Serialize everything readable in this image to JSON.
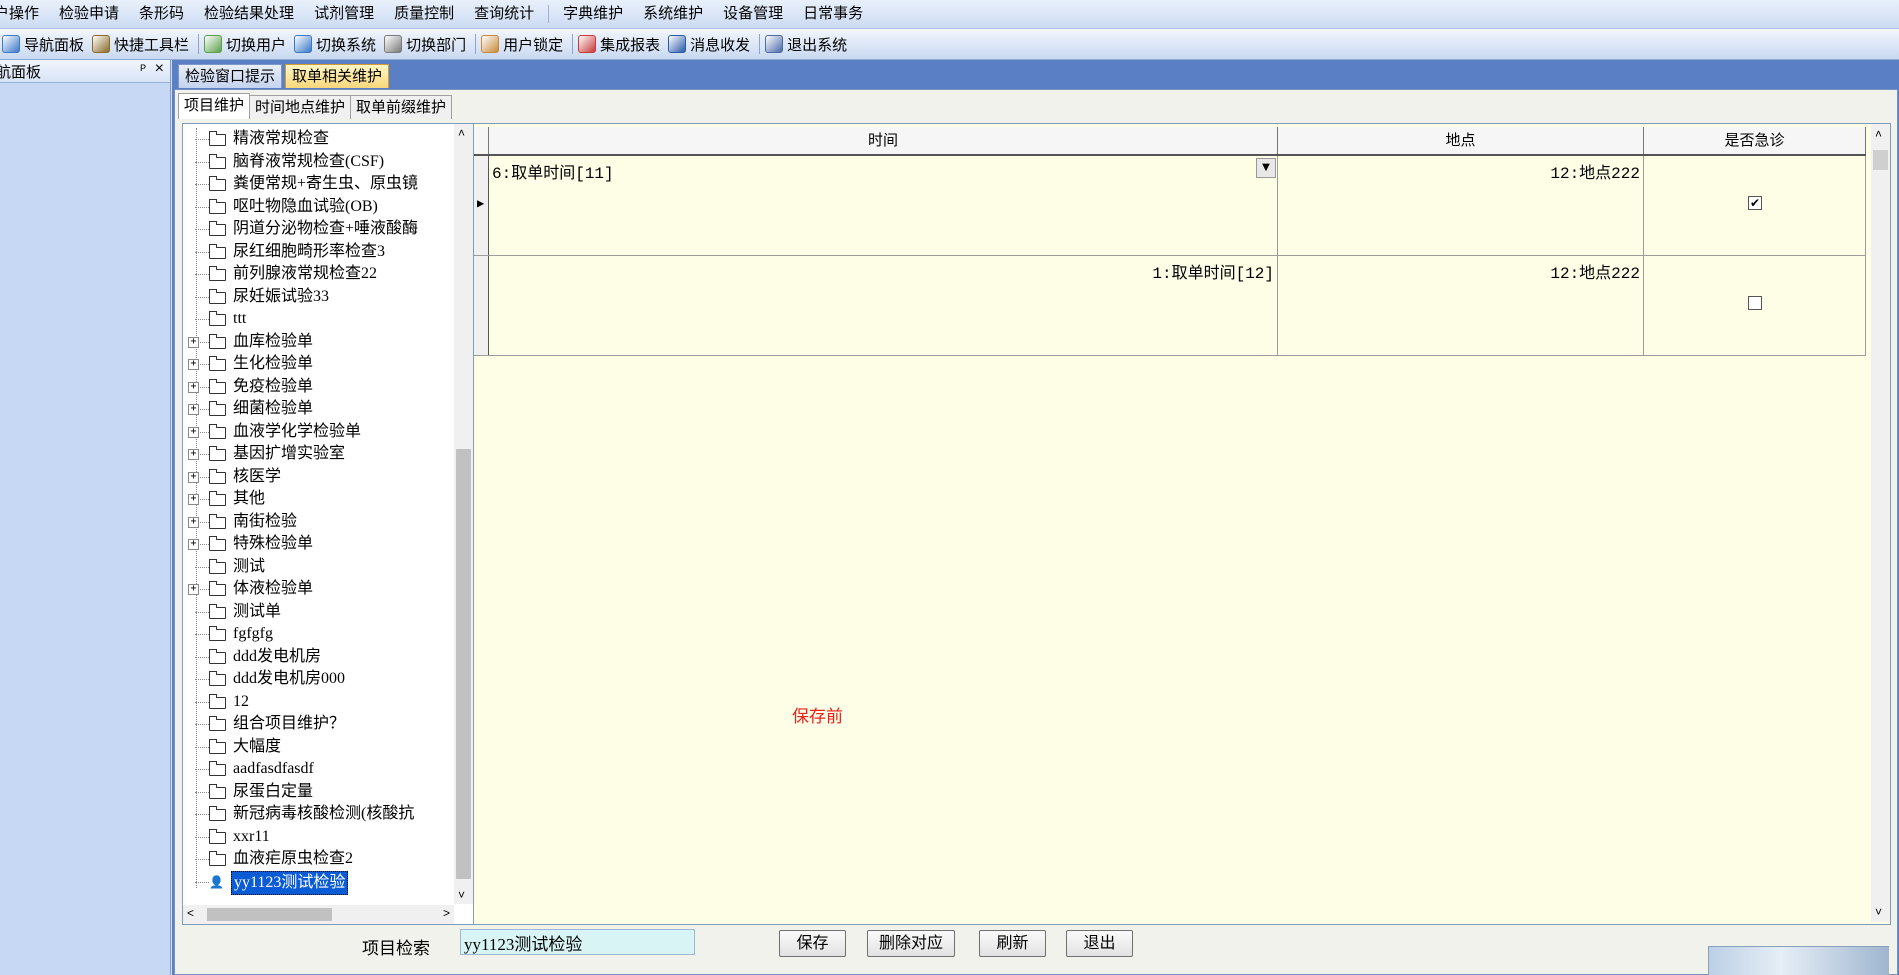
{
  "menu": [
    "户操作",
    "检验申请",
    "条形码",
    "检验结果处理",
    "试剂管理",
    "质量控制",
    "查询统计",
    "字典维护",
    "系统维护",
    "设备管理",
    "日常事务"
  ],
  "toolbar": [
    "导航面板",
    "快捷工具栏",
    "切换用户",
    "切换系统",
    "切换部门",
    "用户锁定",
    "集成报表",
    "消息收发",
    "退出系统"
  ],
  "nav_panel": {
    "title": "航面板",
    "pin": "ᵖ",
    "close": "×"
  },
  "doc_tabs": [
    "检验窗口提示",
    "取单相关维护"
  ],
  "inner_tabs": [
    "项目维护",
    "时间地点维护",
    "取单前缀维护"
  ],
  "tree_items": [
    {
      "label": "精液常规检查",
      "expand": false
    },
    {
      "label": "脑脊液常规检查(CSF)",
      "expand": false
    },
    {
      "label": "粪便常规+寄生虫、原虫镜",
      "expand": false
    },
    {
      "label": "呕吐物隐血试验(OB)",
      "expand": false
    },
    {
      "label": "阴道分泌物检查+唾液酸酶",
      "expand": false
    },
    {
      "label": "尿红细胞畸形率检查3",
      "expand": false
    },
    {
      "label": "前列腺液常规检查22",
      "expand": false
    },
    {
      "label": "尿妊娠试验33",
      "expand": false
    },
    {
      "label": "ttt",
      "expand": false
    },
    {
      "label": "血库检验单",
      "expand": true
    },
    {
      "label": "生化检验单",
      "expand": true
    },
    {
      "label": "免疫检验单",
      "expand": true
    },
    {
      "label": "细菌检验单",
      "expand": true
    },
    {
      "label": "血液学化学检验单",
      "expand": true
    },
    {
      "label": "基因扩增实验室",
      "expand": true
    },
    {
      "label": "核医学",
      "expand": true
    },
    {
      "label": "其他",
      "expand": true
    },
    {
      "label": "南街检验",
      "expand": true
    },
    {
      "label": "特殊检验单",
      "expand": true
    },
    {
      "label": "测试",
      "expand": false
    },
    {
      "label": "体液检验单",
      "expand": true
    },
    {
      "label": "测试单",
      "expand": false
    },
    {
      "label": " fgfgfg",
      "expand": false
    },
    {
      "label": "ddd发电机房",
      "expand": false
    },
    {
      "label": "ddd发电机房000",
      "expand": false
    },
    {
      "label": "12",
      "expand": false
    },
    {
      "label": "组合项目维护？",
      "expand": false
    },
    {
      "label": " 大幅度",
      "expand": false
    },
    {
      "label": " aadfasdfasdf",
      "expand": false
    },
    {
      "label": "尿蛋白定量",
      "expand": false
    },
    {
      "label": "新冠病毒核酸检测(核酸抗",
      "expand": false
    },
    {
      "label": "xxr11",
      "expand": false
    },
    {
      "label": "血液疟原虫检查2",
      "expand": false
    },
    {
      "label": "yy1123测试检验",
      "expand": false,
      "selected": true
    }
  ],
  "grid": {
    "headers": {
      "time": "时间",
      "place": "地点",
      "urgent": "是否急诊"
    },
    "rows": [
      {
        "time": "6:取单时间[11]",
        "place": "12:地点222",
        "urgent": true,
        "current": true
      },
      {
        "time": "1:取单时间[12]",
        "place": "12:地点222",
        "urgent": false,
        "current": false
      }
    ]
  },
  "status_note": "保存前",
  "search": {
    "label": "项目检索",
    "value": "yy1123测试检验"
  },
  "buttons": {
    "save": "保存",
    "delete": "删除对应",
    "refresh": "刷新",
    "exit": "退出"
  }
}
